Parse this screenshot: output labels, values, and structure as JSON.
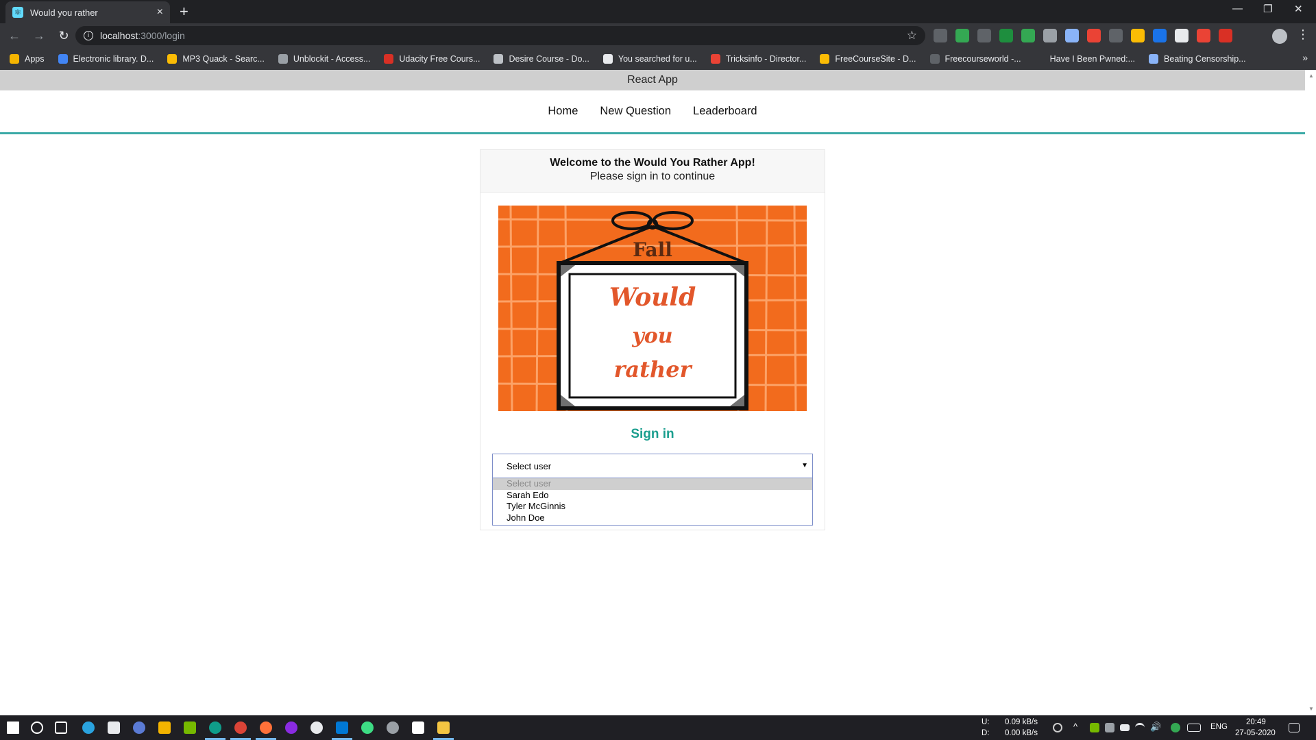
{
  "browser": {
    "tab_title": "Would you rather",
    "url_host": "localhost",
    "url_path": ":3000/login",
    "bookmarks": [
      {
        "label": "Apps",
        "color": "#f4b400"
      },
      {
        "label": "Electronic library. D...",
        "color": "#4285f4"
      },
      {
        "label": "MP3 Quack - Searc...",
        "color": "#fbbc05"
      },
      {
        "label": "Unblockit - Access...",
        "color": "#9aa0a6"
      },
      {
        "label": "Udacity Free Cours...",
        "color": "#d93025"
      },
      {
        "label": "Desire Course - Do...",
        "color": "#bdc1c6"
      },
      {
        "label": "You searched for u...",
        "color": "#e8eaed"
      },
      {
        "label": "Tricksinfo - Director...",
        "color": "#ea4335"
      },
      {
        "label": "FreeCourseSite - D...",
        "color": "#fbbc05"
      },
      {
        "label": "Freecourseworld -...",
        "color": "#5f6368"
      },
      {
        "label": "Have I Been Pwned:...",
        "color": "#35363a"
      },
      {
        "label": "Beating Censorship...",
        "color": "#8ab4f8"
      }
    ],
    "extension_colors": [
      "#5f6368",
      "#34a853",
      "#5f6368",
      "#1e8e3e",
      "#34a853",
      "#9aa0a6",
      "#8ab4f8",
      "#ea4335",
      "#5f6368",
      "#fbbc05",
      "#1a73e8",
      "#e8eaed",
      "#ea4335",
      "#d93025"
    ]
  },
  "app": {
    "title": "React App",
    "nav": [
      "Home",
      "New Question",
      "Leaderboard"
    ],
    "accent": "#3aa9a6"
  },
  "login": {
    "welcome": "Welcome to the Would You Rather App!",
    "subtitle": "Please sign in to continue",
    "banner_fall": "Fall",
    "banner_line1": "Would",
    "banner_line2": "you",
    "banner_line3": "rather",
    "signin_heading": "Sign in",
    "select_value": "Select user",
    "options": [
      "Select user",
      "Sarah Edo",
      "Tyler McGinnis",
      "John Doe"
    ]
  },
  "taskbar": {
    "upload_label": "U:",
    "upload_rate": "0.09 kB/s",
    "download_label": "D:",
    "download_rate": "0.00 kB/s",
    "language": "ENG",
    "time": "20:49",
    "date": "27-05-2020"
  }
}
